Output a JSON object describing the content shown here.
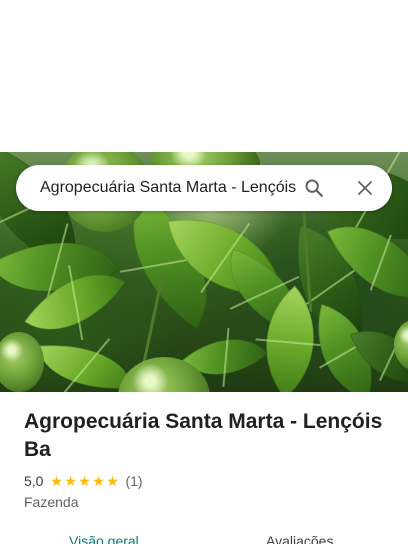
{
  "search": {
    "query": "Agropecuária Santa Marta - Lençóis"
  },
  "icons": {
    "search": "search-icon",
    "close": "close-icon",
    "star": "star-icon"
  },
  "place": {
    "name": "Agropecuária Santa Marta - Lençóis Ba",
    "rating_value": "5,0",
    "stars": [
      "★",
      "★",
      "★",
      "★",
      "★"
    ],
    "rating": 5.0,
    "review_count": "(1)",
    "category": "Fazenda"
  },
  "tabs": [
    {
      "label": "Visão geral",
      "active": true
    },
    {
      "label": "Avaliações",
      "active": false
    }
  ],
  "colors": {
    "star": "#fbbc04",
    "active_tab": "#0b7a75",
    "text_primary": "#202124",
    "text_secondary": "#5f6368"
  }
}
